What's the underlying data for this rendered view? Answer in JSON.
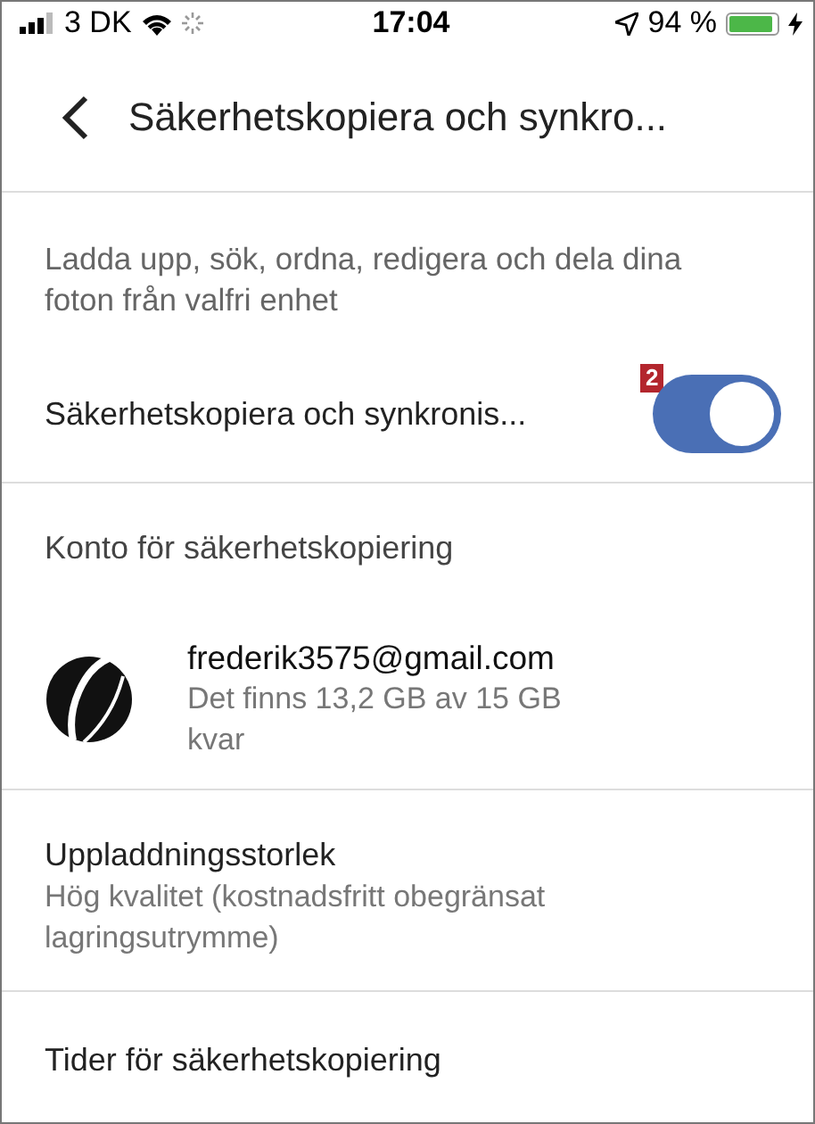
{
  "status_bar": {
    "carrier": "3 DK",
    "time": "17:04",
    "battery_text": "94 %"
  },
  "header": {
    "title": "Säkerhetskopiera och synkro..."
  },
  "description": "Ladda upp, sök, ordna, redigera och dela dina foton från valfri enhet",
  "backup_toggle": {
    "label": "Säkerhetskopiera och synkronis...",
    "on": true,
    "badge": "2"
  },
  "account_section": {
    "heading": "Konto för säkerhetskopiering",
    "email": "frederik3575@gmail.com",
    "storage": "Det finns 13,2 GB av 15 GB kvar"
  },
  "settings": [
    {
      "title": "Uppladdningsstorlek",
      "subtitle": "Hög kvalitet (kostnadsfritt obegränsat lagringsutrymme)"
    },
    {
      "title": "Tider för säkerhetskopiering"
    }
  ]
}
